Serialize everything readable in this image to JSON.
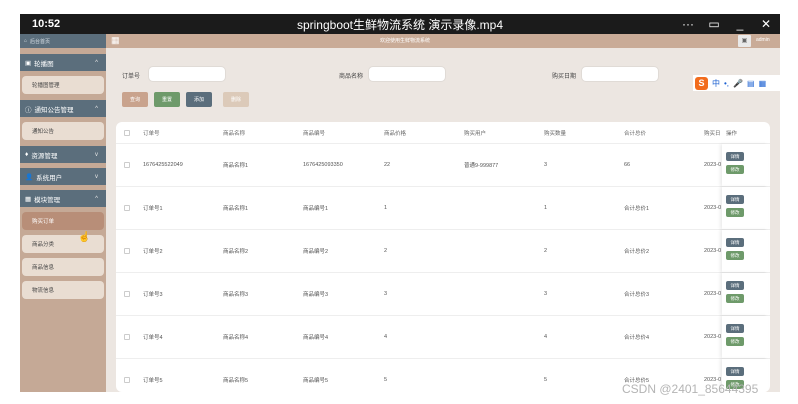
{
  "player": {
    "time": "10:52",
    "title": "springboot生鲜物流系统 演示录像.mp4",
    "more": "···",
    "minimize": "_",
    "close": "✕"
  },
  "header": {
    "back_home": "后台首页",
    "welcome": "欢迎使用生鲜物流系统",
    "user": "admin"
  },
  "sidebar": {
    "groups": [
      {
        "icon": "▣",
        "label": "轮播图",
        "items": [
          "轮播图管理"
        ]
      },
      {
        "icon": "ⓘ",
        "label": "通知公告管理",
        "items": [
          "通知公告"
        ]
      },
      {
        "icon": "♦",
        "label": "资源管理",
        "items": []
      },
      {
        "icon": "👤",
        "label": "系统用户",
        "items": []
      },
      {
        "icon": "▦",
        "label": "模块管理",
        "items": [
          "购买订单",
          "商品分类",
          "商品信息",
          "物流信息"
        ]
      }
    ],
    "active_item": "购买订单"
  },
  "search": {
    "order_no_label": "订单号",
    "product_name_label": "商品名称",
    "purchase_date_label": "购买日期"
  },
  "buttons": {
    "search": "查询",
    "reset": "重置",
    "add": "添加",
    "delete": "删除"
  },
  "ime": {
    "logo": "S",
    "lang": "中",
    "punct": "•,",
    "mic": "🎤",
    "keyboard": "▤",
    "grid": "▦"
  },
  "table": {
    "columns": [
      "订单号",
      "商品名称",
      "商品编号",
      "商品价格",
      "购买用户",
      "购买数量",
      "合计总价",
      "购买日",
      "操作"
    ],
    "rows": [
      [
        "1676425522049",
        "商品名称1",
        "1676425093350",
        "22",
        "普通9-999877",
        "3",
        "66",
        "2023-0"
      ],
      [
        "订单号1",
        "商品名称1",
        "商品编号1",
        "1",
        "",
        "1",
        "合计总价1",
        "2023-0"
      ],
      [
        "订单号2",
        "商品名称2",
        "商品编号2",
        "2",
        "",
        "2",
        "合计总价2",
        "2023-0"
      ],
      [
        "订单号3",
        "商品名称3",
        "商品编号3",
        "3",
        "",
        "3",
        "合计总价3",
        "2023-0"
      ],
      [
        "订单号4",
        "商品名称4",
        "商品编号4",
        "4",
        "",
        "4",
        "合计总价4",
        "2023-0"
      ],
      [
        "订单号5",
        "商品名称5",
        "商品编号5",
        "5",
        "",
        "5",
        "合计总价5",
        "2023-0"
      ]
    ],
    "detail_label": "详情",
    "edit_label": "修改"
  },
  "watermark": "CSDN @2401_85644395",
  "colors": {
    "sidebar_dark": "#5b6e7c",
    "sidebar_bg": "#c5a996",
    "active": "#b88e78",
    "search_btn": "#c9a38d",
    "reset_btn": "#6e9a6a",
    "add_btn": "#5b6e7c",
    "delete_btn": "#dccab9"
  }
}
